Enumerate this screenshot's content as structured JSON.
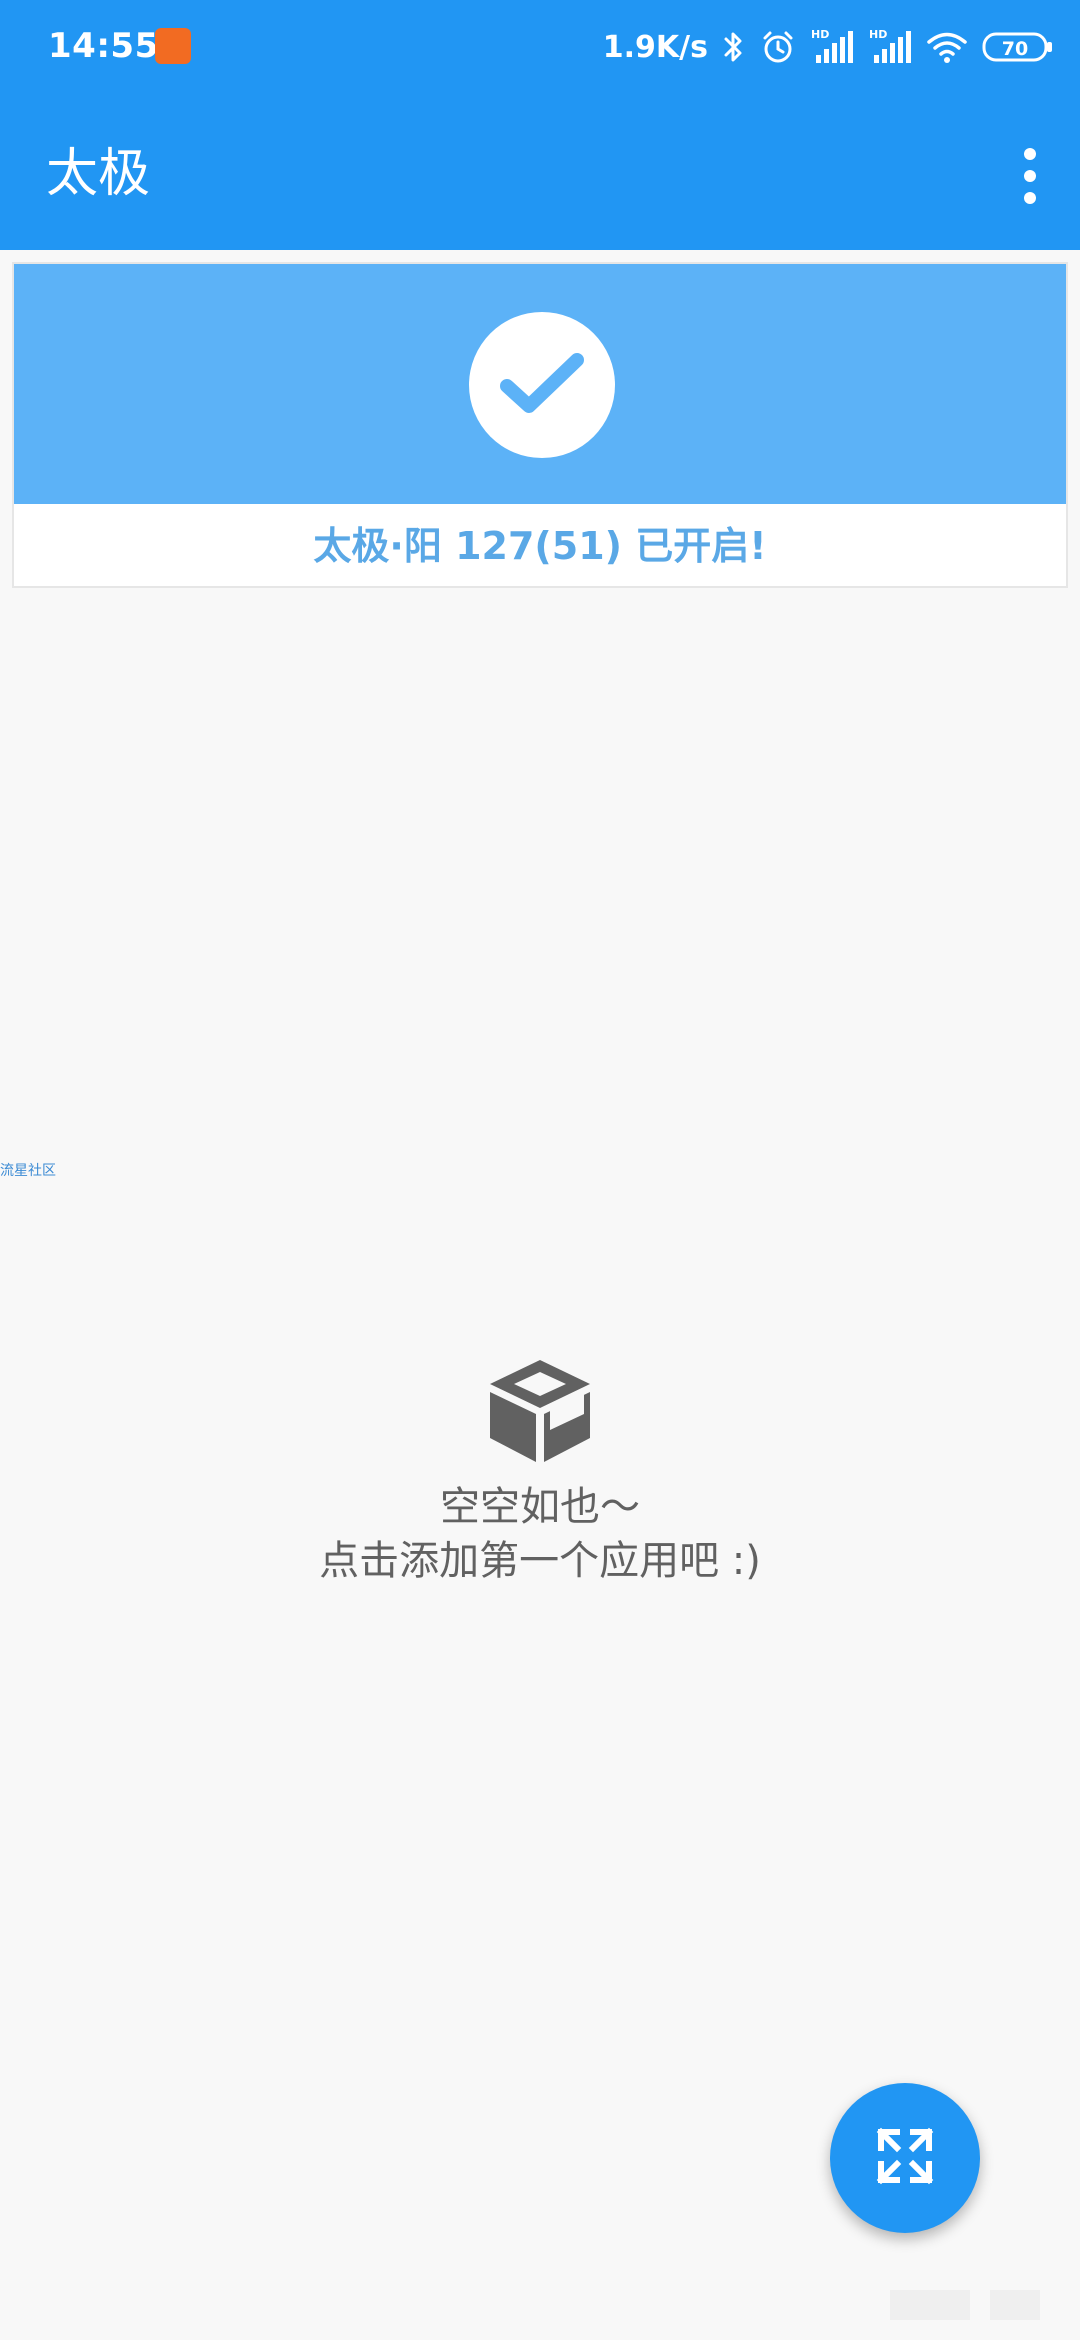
{
  "status_bar": {
    "time": "14:55",
    "network_speed": "1.9K/s",
    "battery": "70",
    "notification_color": "#f26b22",
    "icons": [
      "bluetooth-icon",
      "alarm-icon",
      "signal-hd-icon",
      "signal-hd-icon",
      "wifi-icon",
      "battery-icon"
    ]
  },
  "app_bar": {
    "title": "太极",
    "menu_icon": "overflow-menu-icon"
  },
  "status_card": {
    "icon": "check-icon",
    "text": "太极·阳 127(51) 已开启!"
  },
  "watermark": {
    "text": "流星社区"
  },
  "empty_state": {
    "icon": "box-icon",
    "line1": "空空如也～",
    "line2": "点击添加第一个应用吧 :)"
  },
  "fab": {
    "icon": "expand-arrows-icon"
  },
  "colors": {
    "primary": "#2196F3",
    "banner": "#5cb2f7",
    "status_text": "#5aa8e6",
    "background": "#f8f8f8"
  }
}
